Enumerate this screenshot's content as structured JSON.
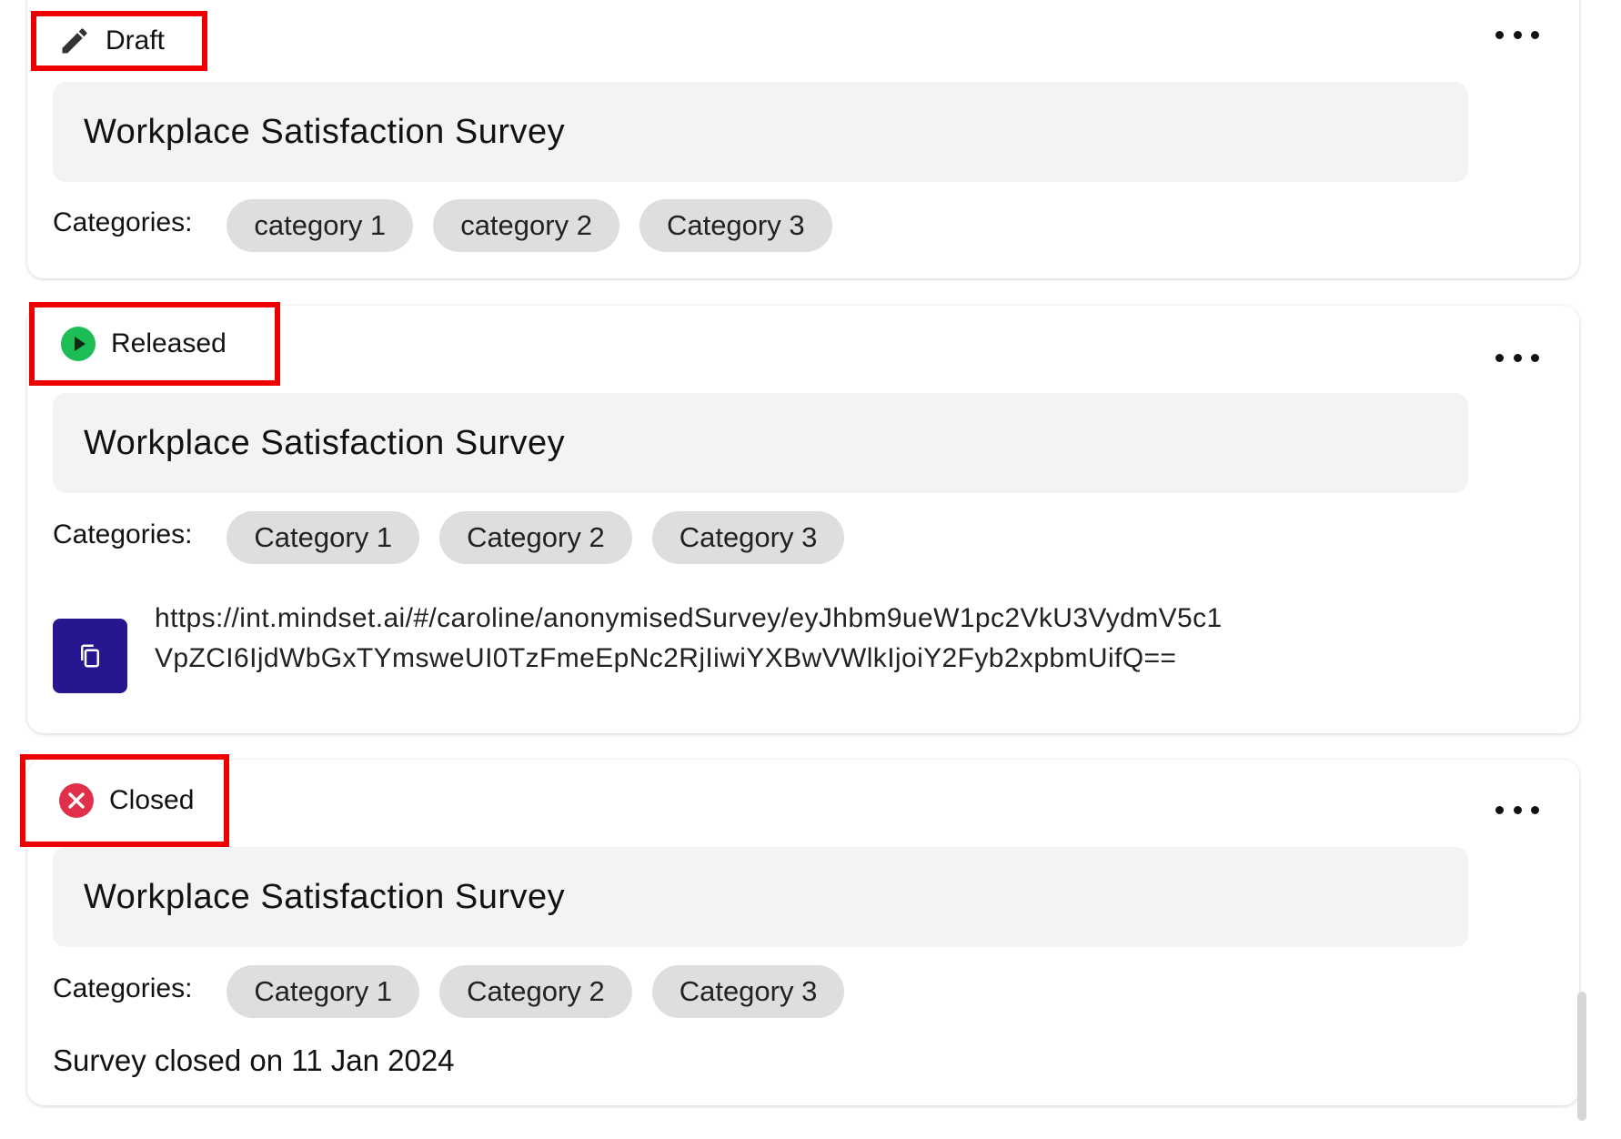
{
  "colors": {
    "highlight": "#ee0000",
    "released_green": "#1dbd55",
    "closed_red": "#e0304a",
    "copy_button": "#26168f",
    "chip_bg": "#dedede",
    "title_bg": "#f3f3f3"
  },
  "surveys": [
    {
      "status": "Draft",
      "status_icon": "pencil-icon",
      "title": "Workplace Satisfaction Survey",
      "categories_label": "Categories:",
      "categories": [
        "category 1",
        "category 2",
        "Category 3"
      ]
    },
    {
      "status": "Released",
      "status_icon": "play-circle-icon",
      "title": "Workplace Satisfaction Survey",
      "categories_label": "Categories:",
      "categories": [
        "Category 1",
        "Category 2",
        "Category 3"
      ],
      "link": "https://int.mindset.ai/#/caroline/anonymisedSurvey/eyJhbm9ueW1pc2VkU3VydmV5c1VpZCI6IjdWbGxTYmsweUI0TzFmeEpNc2RjIiwiYXBwVWlkIjoiY2Fyb2xpbmUifQ==",
      "copy_icon": "copy-icon"
    },
    {
      "status": "Closed",
      "status_icon": "x-circle-icon",
      "title": "Workplace Satisfaction Survey",
      "categories_label": "Categories:",
      "categories": [
        "Category 1",
        "Category 2",
        "Category 3"
      ],
      "closed_note": "Survey closed on 11 Jan 2024"
    }
  ]
}
